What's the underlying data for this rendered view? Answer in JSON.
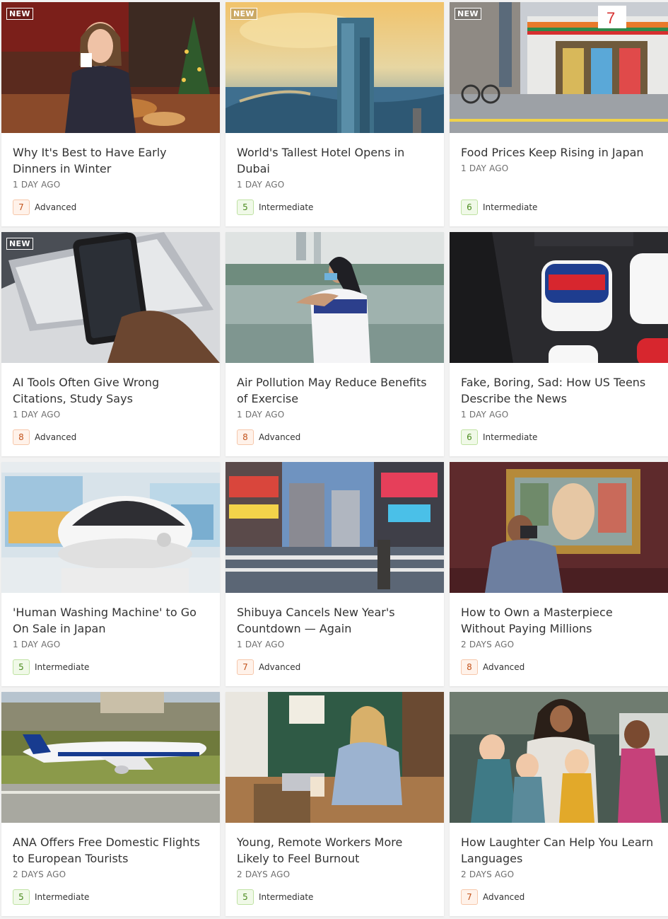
{
  "new_label": "NEW",
  "colors": {
    "advanced": "#c2531c",
    "intermediate": "#4a8a1e"
  },
  "articles": [
    {
      "title": "Why It's Best to Have Early Dinners in Winter",
      "age": "1 DAY AGO",
      "level": "7",
      "level_label": "Advanced",
      "is_new": true,
      "image": "woman-at-dinner-table"
    },
    {
      "title": "World's Tallest Hotel Opens in Dubai",
      "age": "1 DAY AGO",
      "level": "5",
      "level_label": "Intermediate",
      "is_new": true,
      "image": "dubai-skyscraper"
    },
    {
      "title": "Food Prices Keep Rising in Japan",
      "age": "1 DAY AGO",
      "level": "6",
      "level_label": "Intermediate",
      "is_new": true,
      "image": "japan-convenience-store"
    },
    {
      "title": "AI Tools Often Give Wrong Citations, Study Says",
      "age": "1 DAY AGO",
      "level": "8",
      "level_label": "Advanced",
      "is_new": true,
      "image": "phone-chatgpt"
    },
    {
      "title": "Air Pollution May Reduce Benefits of Exercise",
      "age": "1 DAY AGO",
      "level": "8",
      "level_label": "Advanced",
      "is_new": false,
      "image": "woman-mask-lake"
    },
    {
      "title": "Fake, Boring, Sad: How US Teens Describe the News",
      "age": "1 DAY AGO",
      "level": "6",
      "level_label": "Intermediate",
      "is_new": false,
      "image": "news-app-icons"
    },
    {
      "title": "'Human Washing Machine' to Go On Sale in Japan",
      "age": "1 DAY AGO",
      "level": "5",
      "level_label": "Intermediate",
      "is_new": false,
      "image": "washing-machine-pod"
    },
    {
      "title": "Shibuya Cancels New Year's Countdown — Again",
      "age": "1 DAY AGO",
      "level": "7",
      "level_label": "Advanced",
      "is_new": false,
      "image": "shibuya-crossing"
    },
    {
      "title": "How to Own a Masterpiece Without Paying Millions",
      "age": "2 DAYS AGO",
      "level": "8",
      "level_label": "Advanced",
      "is_new": false,
      "image": "man-photographing-painting"
    },
    {
      "title": "ANA Offers Free Domestic Flights to European Tourists",
      "age": "2 DAYS AGO",
      "level": "5",
      "level_label": "Intermediate",
      "is_new": false,
      "image": "ana-airplane"
    },
    {
      "title": "Young, Remote Workers More Likely to Feel Burnout",
      "age": "2 DAYS AGO",
      "level": "5",
      "level_label": "Intermediate",
      "is_new": false,
      "image": "woman-laptop-cafe"
    },
    {
      "title": "How Laughter Can Help You Learn Languages",
      "age": "2 DAYS AGO",
      "level": "7",
      "level_label": "Advanced",
      "is_new": false,
      "image": "teacher-children-laughing"
    }
  ]
}
